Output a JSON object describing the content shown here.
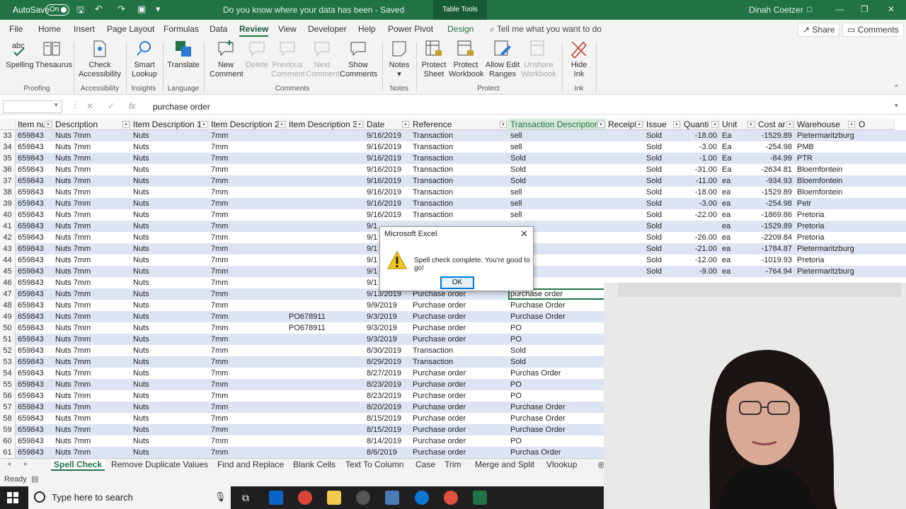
{
  "titlebar": {
    "autosave_label": "AutoSave",
    "autosave_state": "On",
    "doc_title": "Do you know where your data has been  -  Saved",
    "table_tools": "Table Tools",
    "user": "Dinah Coetzer"
  },
  "menu": {
    "tabs": [
      "File",
      "Home",
      "Insert",
      "Page Layout",
      "Formulas",
      "Data",
      "Review",
      "View",
      "Developer",
      "Help",
      "Power Pivot",
      "Design"
    ],
    "active_tab": "Review",
    "tell_me": "Tell me what you want to do",
    "share": "Share",
    "comments": "Comments"
  },
  "ribbon": {
    "spelling": "Spelling",
    "thesaurus": "Thesaurus",
    "check_accessibility_1": "Check",
    "check_accessibility_2": "Accessibility",
    "smart_lookup_1": "Smart",
    "smart_lookup_2": "Lookup",
    "translate": "Translate",
    "new_comment_1": "New",
    "new_comment_2": "Comment",
    "delete": "Delete",
    "previous_1": "Previous",
    "previous_2": "Comment",
    "next_1": "Next",
    "next_2": "Comment",
    "show_1": "Show",
    "show_2": "Comments",
    "notes": "Notes",
    "protect_sheet_1": "Protect",
    "protect_sheet_2": "Sheet",
    "protect_wb_1": "Protect",
    "protect_wb_2": "Workbook",
    "allow_edit_1": "Allow Edit",
    "allow_edit_2": "Ranges",
    "unshare_1": "Unshare",
    "unshare_2": "Workbook",
    "hide_ink_1": "Hide",
    "hide_ink_2": "Ink",
    "groups": {
      "proofing": "Proofing",
      "accessibility": "Accessibility",
      "insights": "Insights",
      "language": "Language",
      "comments": "Comments",
      "notes": "Notes",
      "protect": "Protect",
      "ink": "Ink"
    }
  },
  "formula_bar": {
    "fx": "fx",
    "value": "purchase order"
  },
  "columns": [
    "Item nu",
    "Description",
    "Item Description 1",
    "Item Description 2",
    "Item Description 3",
    "Date",
    "Reference",
    "Transaction Description",
    "Receipt",
    "Issue",
    "Quanti",
    "Unit",
    "Cost ar",
    "Warehouse",
    "O"
  ],
  "rows": [
    [
      "33",
      "659843",
      "Nuts 7mm",
      "Nuts",
      "7mm",
      "",
      "9/16/2019",
      "Transaction",
      "sell",
      "",
      "Sold",
      "-18.00",
      "Ea",
      "-1529.89",
      "Pietermaritzburg"
    ],
    [
      "34",
      "659843",
      "Nuts 7mm",
      "Nuts",
      "7mm",
      "",
      "9/16/2019",
      "Transaction",
      "sell",
      "",
      "Sold",
      "-3.00",
      "Ea",
      "-254.98",
      "PMB"
    ],
    [
      "35",
      "659843",
      "Nuts 7mm",
      "Nuts",
      "7mm",
      "",
      "9/16/2019",
      "Transaction",
      "Sold",
      "",
      "Sold",
      "-1.00",
      "Ea",
      "-84.99",
      "PTR"
    ],
    [
      "36",
      "659843",
      "Nuts 7mm",
      "Nuts",
      "7mm",
      "",
      "9/16/2019",
      "Transaction",
      "Sold",
      "",
      "Sold",
      "-31.00",
      "Ea",
      "-2634.81",
      "Bloemfontein"
    ],
    [
      "37",
      "659843",
      "Nuts 7mm",
      "Nuts",
      "7mm",
      "",
      "9/16/2019",
      "Transaction",
      "Sold",
      "",
      "Sold",
      "-11.00",
      "ea",
      "-934.93",
      "Bloemfontein"
    ],
    [
      "38",
      "659843",
      "Nuts 7mm",
      "Nuts",
      "7mm",
      "",
      "9/16/2019",
      "Transaction",
      "sell",
      "",
      "Sold",
      "-18.00",
      "ea",
      "-1529.89",
      "Bloemfontein"
    ],
    [
      "39",
      "659843",
      "Nuts 7mm",
      "Nuts",
      "7mm",
      "",
      "9/16/2019",
      "Transaction",
      "sell",
      "",
      "Sold",
      "-3.00",
      "ea",
      "-254.98",
      "Petr"
    ],
    [
      "40",
      "659843",
      "Nuts 7mm",
      "Nuts",
      "7mm",
      "",
      "9/16/2019",
      "Transaction",
      "sell",
      "",
      "Sold",
      "-22.00",
      "ea",
      "-1869.86",
      "Pretoria"
    ],
    [
      "41",
      "659843",
      "Nuts 7mm",
      "Nuts",
      "7mm",
      "",
      "9/1",
      "",
      "",
      "",
      "Sold",
      "",
      "ea",
      "-1529.89",
      "Pretoria"
    ],
    [
      "42",
      "659843",
      "Nuts 7mm",
      "Nuts",
      "7mm",
      "",
      "9/1",
      "",
      "",
      "",
      "Sold",
      "-26.00",
      "ea",
      "-2209.84",
      "Pretoria"
    ],
    [
      "43",
      "659843",
      "Nuts 7mm",
      "Nuts",
      "7mm",
      "",
      "9/1",
      "",
      "",
      "",
      "Sold",
      "-21.00",
      "ea",
      "-1784.87",
      "Pietermaritzburg"
    ],
    [
      "44",
      "659843",
      "Nuts 7mm",
      "Nuts",
      "7mm",
      "",
      "9/1",
      "",
      "",
      "",
      "Sold",
      "-12.00",
      "ea",
      "-1019.93",
      "Pretoria"
    ],
    [
      "45",
      "659843",
      "Nuts 7mm",
      "Nuts",
      "7mm",
      "",
      "9/1",
      "",
      "",
      "",
      "Sold",
      "-9.00",
      "ea",
      "-764.94",
      "Pietermaritzburg"
    ],
    [
      "46",
      "659843",
      "Nuts 7mm",
      "Nuts",
      "7mm",
      "",
      "9/1",
      "",
      "",
      "",
      "",
      "",
      "",
      "",
      ""
    ],
    [
      "47",
      "659843",
      "Nuts 7mm",
      "Nuts",
      "7mm",
      "",
      "9/13/2019",
      "Purchase order",
      "purchase order",
      "",
      "",
      "",
      "",
      "",
      ""
    ],
    [
      "48",
      "659843",
      "Nuts 7mm",
      "Nuts",
      "7mm",
      "",
      "9/9/2019",
      "Purchase order",
      "Purchase Order",
      "",
      "",
      "",
      "",
      "",
      ""
    ],
    [
      "49",
      "659843",
      "Nuts 7mm",
      "Nuts",
      "7mm",
      "PO678911",
      "9/3/2019",
      "Purchase order",
      "Purchase Order",
      "",
      "",
      "",
      "",
      "",
      ""
    ],
    [
      "50",
      "659843",
      "Nuts 7mm",
      "Nuts",
      "7mm",
      "PO678911",
      "9/3/2019",
      "Purchase order",
      "PO",
      "",
      "",
      "",
      "",
      "",
      ""
    ],
    [
      "51",
      "659843",
      "Nuts 7mm",
      "Nuts",
      "7mm",
      "",
      "9/3/2019",
      "Purchase order",
      "PO",
      "",
      "",
      "",
      "",
      "",
      ""
    ],
    [
      "52",
      "659843",
      "Nuts 7mm",
      "Nuts",
      "7mm",
      "",
      "8/30/2019",
      "Transaction",
      "Sold",
      "",
      "",
      "",
      "",
      "",
      ""
    ],
    [
      "53",
      "659843",
      "Nuts 7mm",
      "Nuts",
      "7mm",
      "",
      "8/29/2019",
      "Transaction",
      "Sold",
      "",
      "",
      "",
      "",
      "",
      ""
    ],
    [
      "54",
      "659843",
      "Nuts 7mm",
      "Nuts",
      "7mm",
      "",
      "8/27/2019",
      "Purchase order",
      "Purchas Order",
      "",
      "",
      "",
      "",
      "",
      ""
    ],
    [
      "55",
      "659843",
      "Nuts 7mm",
      "Nuts",
      "7mm",
      "",
      "8/23/2019",
      "Purchase order",
      "PO",
      "",
      "",
      "",
      "",
      "",
      ""
    ],
    [
      "56",
      "659843",
      "Nuts 7mm",
      "Nuts",
      "7mm",
      "",
      "8/23/2019",
      "Purchase order",
      "PO",
      "",
      "",
      "",
      "",
      "",
      ""
    ],
    [
      "57",
      "659843",
      "Nuts 7mm",
      "Nuts",
      "7mm",
      "",
      "8/20/2019",
      "Purchase order",
      "Purchase Order",
      "",
      "",
      "",
      "",
      "",
      ""
    ],
    [
      "58",
      "659843",
      "Nuts 7mm",
      "Nuts",
      "7mm",
      "",
      "8/15/2019",
      "Purchase order",
      "Purchase Order",
      "",
      "",
      "",
      "",
      "",
      ""
    ],
    [
      "59",
      "659843",
      "Nuts 7mm",
      "Nuts",
      "7mm",
      "",
      "8/15/2019",
      "Purchase order",
      "Purchase Order",
      "",
      "",
      "",
      "",
      "",
      ""
    ],
    [
      "60",
      "659843",
      "Nuts 7mm",
      "Nuts",
      "7mm",
      "",
      "8/14/2019",
      "Purchase order",
      "PO",
      "",
      "",
      "",
      "",
      "",
      ""
    ],
    [
      "61",
      "659843",
      "Nuts 7mm",
      "Nuts",
      "7mm",
      "",
      "8/6/2019",
      "Purchase order",
      "Purchas Order",
      "",
      "",
      "",
      "",
      "",
      ""
    ]
  ],
  "dialog": {
    "title": "Microsoft Excel",
    "message": "Spell check complete. You're good to go!",
    "ok": "OK"
  },
  "sheet_tabs": [
    "Spell Check",
    "Remove Duplicate Values",
    "Find and Replace",
    "Blank Cells",
    "Text To Column",
    "Case",
    "Trim",
    "Merge and Split",
    "Vlookup"
  ],
  "status": "Ready",
  "taskbar": {
    "search_placeholder": "Type here to search"
  },
  "colors": {
    "excel_green": "#217346",
    "band": "#dde4f4"
  }
}
